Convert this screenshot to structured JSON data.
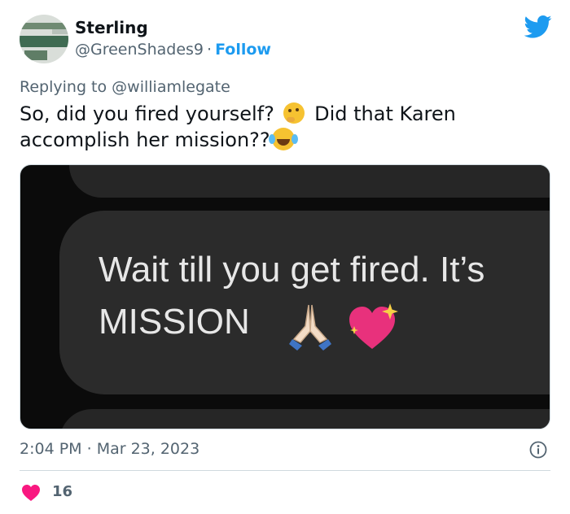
{
  "author": {
    "display_name": "Sterling",
    "handle": "@GreenShades9",
    "separator": "·",
    "follow_label": "Follow"
  },
  "reply": {
    "prefix": "Replying to",
    "mention": "@williamlegate"
  },
  "tweet": {
    "text_part1": "So, did you fired yourself?",
    "text_part2": "Did that Karen accomplish her mission??"
  },
  "media": {
    "line1": "Wait till you get fired. It’s",
    "line2": "MISSION"
  },
  "meta": {
    "time": "2:04 PM",
    "separator": "·",
    "date": "Mar 23, 2023"
  },
  "engagement": {
    "likes": "16"
  },
  "icons": {
    "brand": "twitter-bird-icon",
    "info": "info-icon",
    "like": "heart-icon",
    "emoji_think": "thinking-face-icon",
    "emoji_laugh": "tears-of-joy-icon",
    "emoji_pray": "folded-hands-icon",
    "emoji_heart": "sparkling-heart-icon"
  },
  "colors": {
    "accent": "#1d9bf0",
    "like": "#f91880",
    "muted": "#536471"
  }
}
